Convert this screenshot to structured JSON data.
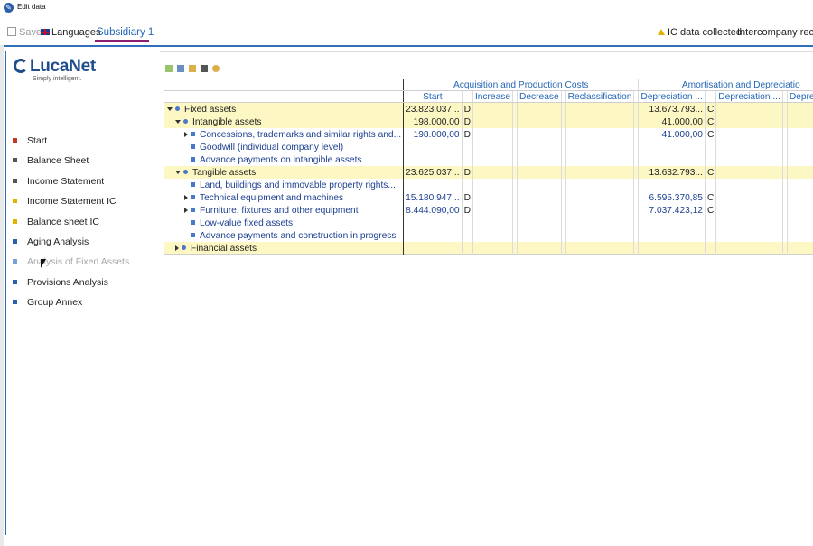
{
  "window": {
    "title": "Edit data"
  },
  "toolbar": {
    "save_label": "Save",
    "languages_label": "Languages",
    "subsidiary_label": "Subsidiary 1",
    "ic_status_label": "IC data collected",
    "intercompany_label": "Intercompany recor"
  },
  "logo": {
    "brand": "LucaNet",
    "tagline": "Simply intelligent."
  },
  "sidebar": {
    "items": [
      {
        "label": "Start",
        "color": "#c0392b"
      },
      {
        "label": "Balance Sheet",
        "color": "#555555"
      },
      {
        "label": "Income Statement",
        "color": "#555555"
      },
      {
        "label": "Income Statement IC",
        "color": "#e0b400"
      },
      {
        "label": "Balance sheet IC",
        "color": "#e0b400"
      },
      {
        "label": "Aging Analysis",
        "color": "#2b5fa8"
      },
      {
        "label": "Analysis of Fixed Assets",
        "color": "#7aa0d8"
      },
      {
        "label": "Provisions Analysis",
        "color": "#2b5fa8"
      },
      {
        "label": "Group Annex",
        "color": "#2b5fa8"
      }
    ]
  },
  "grid": {
    "group_headers": [
      "Acquisition and Production Costs",
      "Amortisation and Depreciatio"
    ],
    "columns": [
      "Start",
      "Increase",
      "Decrease",
      "Reclassification",
      "Depreciation ...",
      "Depreciation ...",
      "Depreciation"
    ],
    "rows": [
      {
        "name": "Fixed assets",
        "start": "23.823.037...",
        "start_dc": "D",
        "depr": "13.673.793...",
        "depr_dc": "C"
      },
      {
        "name": "Intangible assets",
        "start": "198.000,00",
        "start_dc": "D",
        "depr": "41.000,00",
        "depr_dc": "C"
      },
      {
        "name": "Concessions, trademarks and similar rights and...",
        "start": "198.000,00",
        "start_dc": "D",
        "depr": "41.000,00",
        "depr_dc": "C"
      },
      {
        "name": "Goodwill (individual company level)",
        "start": "",
        "start_dc": "",
        "depr": "",
        "depr_dc": ""
      },
      {
        "name": "Advance payments on intangible assets",
        "start": "",
        "start_dc": "",
        "depr": "",
        "depr_dc": ""
      },
      {
        "name": "Tangible assets",
        "start": "23.625.037...",
        "start_dc": "D",
        "depr": "13.632.793...",
        "depr_dc": "C"
      },
      {
        "name": "Land, buildings and immovable property rights...",
        "start": "",
        "start_dc": "",
        "depr": "",
        "depr_dc": ""
      },
      {
        "name": "Technical equipment and machines",
        "start": "15.180.947...",
        "start_dc": "D",
        "depr": "6.595.370,85",
        "depr_dc": "C"
      },
      {
        "name": "Furniture, fixtures and other equipment",
        "start": "8.444.090,00",
        "start_dc": "D",
        "depr": "7.037.423,12",
        "depr_dc": "C"
      },
      {
        "name": "Low-value fixed assets",
        "start": "",
        "start_dc": "",
        "depr": "",
        "depr_dc": ""
      },
      {
        "name": "Advance payments and construction in progress",
        "start": "",
        "start_dc": "",
        "depr": "",
        "depr_dc": ""
      },
      {
        "name": "Financial assets",
        "start": "",
        "start_dc": "",
        "depr": "",
        "depr_dc": ""
      }
    ]
  },
  "colors": {
    "accent": "#2f6fb7",
    "highlight_row": "#fdf7c3",
    "tab_underline": "#8b1f6e"
  }
}
